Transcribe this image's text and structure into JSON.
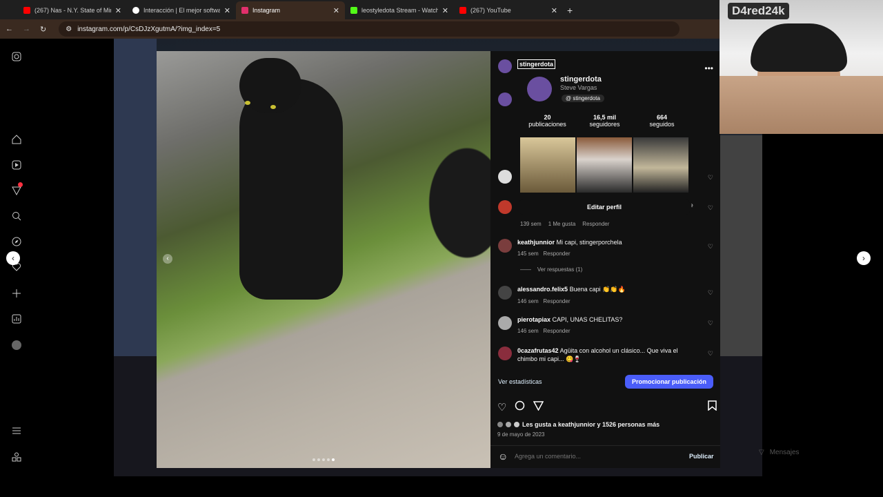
{
  "browser": {
    "tabs": [
      {
        "title": "(267) Nas - N.Y. State of Mind |",
        "color": "#ff0000"
      },
      {
        "title": "Interacción | El mejor software",
        "color": "#ffffff"
      },
      {
        "title": "Instagram",
        "color": "#e1306c",
        "active": true
      },
      {
        "title": "leostyledota Stream - Watch Li",
        "color": "#53fc18"
      },
      {
        "title": "(267) YouTube",
        "color": "#ff0000"
      }
    ],
    "url": "instagram.com/p/CsDJzXgutmA/?img_index=5",
    "new_tab": "+"
  },
  "post": {
    "owner": "stingerdota",
    "hover_card": {
      "username": "stingerdota",
      "full_name": "Steve Vargas",
      "threads_handle": "stingerdota",
      "stats": [
        {
          "value": "20",
          "label": "publicaciones"
        },
        {
          "value": "16,5 mil",
          "label": "seguidores"
        },
        {
          "value": "664",
          "label": "seguidos"
        }
      ],
      "edit_profile": "Editar perfil"
    },
    "partial_text": "te",
    "first_comment_meta": {
      "time": "139 sem",
      "likes": "1 Me gusta",
      "reply": "Responder"
    },
    "comments": [
      {
        "user": "keathjunnior",
        "text": "Mi capi, stingerporchela",
        "time": "145 sem",
        "reply": "Responder",
        "view_replies": "Ver respuestas (1)"
      },
      {
        "user": "alessandro.felix5",
        "text": "Buena capi 👏👏🔥",
        "time": "146 sem",
        "reply": "Responder"
      },
      {
        "user": "pierotapiax",
        "text": "CAPI, UNAS CHELITAS?",
        "time": "146 sem",
        "reply": "Responder"
      },
      {
        "user": "0cazafrutas42",
        "text": "Agüita con alcohol un clásico... Que viva el chimbo mi capi... 😋🍷",
        "time": "146 sem",
        "reply": "Responder"
      }
    ],
    "view_insights": "Ver estadísticas",
    "promote": "Promocionar publicación",
    "likes_text": "Les gusta a keathjunnior y 1526 personas más",
    "date": "9 de mayo de 2023",
    "comment_placeholder": "Agrega un comentario...",
    "publish": "Publicar"
  },
  "messages_label": "Mensajes",
  "webcam_watermark": "D4red24k",
  "colors": {
    "accent": "#4a5df9",
    "link": "#e0f1ff"
  }
}
